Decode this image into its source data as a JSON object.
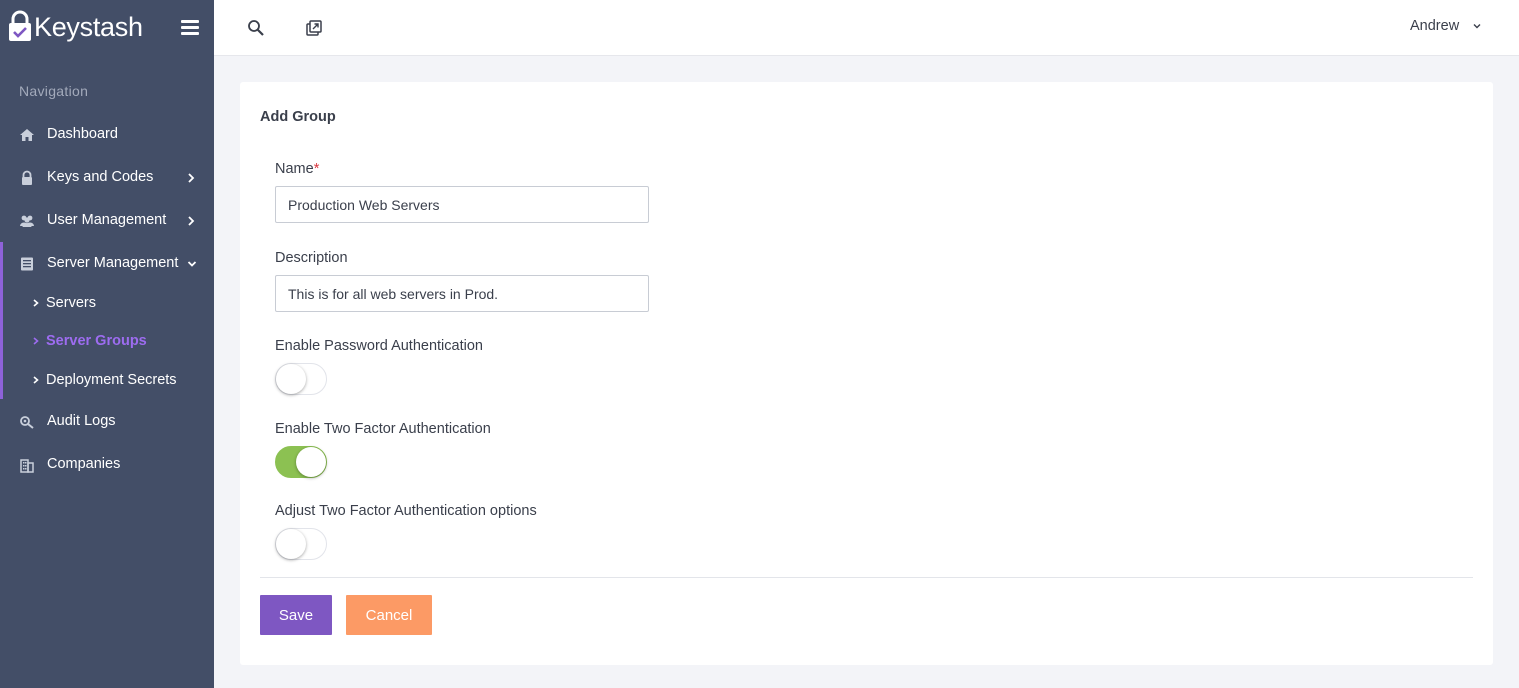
{
  "brand": {
    "name": "Keystash"
  },
  "nav": {
    "caption": "Navigation",
    "items": [
      {
        "label": "Dashboard",
        "icon": "home-icon"
      },
      {
        "label": "Keys and Codes",
        "icon": "lock-icon"
      },
      {
        "label": "User Management",
        "icon": "users-icon"
      },
      {
        "label": "Server Management",
        "icon": "server-icon"
      },
      {
        "label": "Audit Logs",
        "icon": "search-log-icon"
      },
      {
        "label": "Companies",
        "icon": "building-icon"
      }
    ],
    "submenu": [
      {
        "label": "Servers",
        "active": false
      },
      {
        "label": "Server Groups",
        "active": true
      },
      {
        "label": "Deployment Secrets",
        "active": false
      }
    ]
  },
  "topbar": {
    "user_name": "Andrew"
  },
  "form": {
    "title": "Add Group",
    "name_label": "Name",
    "required_mark": "*",
    "name_value": "Production Web Servers",
    "description_label": "Description",
    "description_value": "This is for all web servers in Prod.",
    "toggles": [
      {
        "label": "Enable Password Authentication",
        "on": false
      },
      {
        "label": "Enable Two Factor Authentication",
        "on": true
      },
      {
        "label": "Adjust Two Factor Authentication options",
        "on": false
      }
    ],
    "save_label": "Save",
    "cancel_label": "Cancel"
  },
  "colors": {
    "sidebar": "#434e67",
    "accent": "#7e57c2",
    "active_nav": "#9d6cf0",
    "toggle_on": "#8cc152",
    "cancel": "#fc9a65"
  }
}
